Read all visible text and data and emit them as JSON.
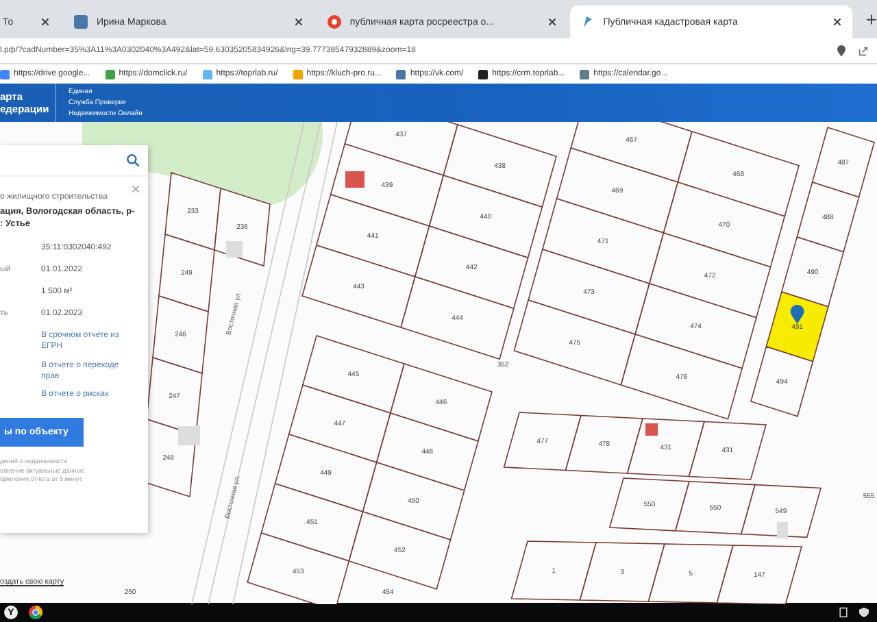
{
  "tabs": [
    {
      "title": "То",
      "kind": "plain",
      "selected": false
    },
    {
      "title": "Ирина Маркова",
      "kind": "vk",
      "selected": false
    },
    {
      "title": "публичная карта росреестра о...",
      "kind": "yandex",
      "selected": false
    },
    {
      "title": "Публичная кадастровая карта",
      "kind": "cadastre",
      "selected": true
    }
  ],
  "new_tab": "+",
  "address_bar": {
    "url": "l.рф/?cadNumber=35%3A11%3A0302040%3A492&lat=59.63035205834926&lng=39.77738547932889&zoom=18"
  },
  "bookmarks": [
    "https://drive.google...",
    "https://domclick.ru/",
    "https://toprlab.ru/",
    "https://kluch-pro.ru...",
    "https://vk.com/",
    "https://crm.toprlab...",
    "https://calendar.go..."
  ],
  "header": {
    "brand": [
      "арта",
      "едерации"
    ],
    "service": [
      "Единая",
      "Служба Проверки",
      "Недвижимости Онлайн"
    ]
  },
  "panel": {
    "type_line": "о жилищного строительства",
    "address_lines": [
      "ация, Вологодская область, р-",
      ": Устье"
    ],
    "fields": [
      {
        "value": "35:11:0302040:492"
      },
      {
        "label": "ый",
        "value": "01.01.2022"
      },
      {
        "value": "1 500 м²"
      },
      {
        "label": "ть",
        "value": "01.02.2023"
      }
    ],
    "links": [
      "В срочном отчете из ЕГРН",
      "В отчете о переходе прав",
      "В отчете о рисках"
    ],
    "button": "ы по объекту",
    "note_lines": [
      "дений о недвижимости",
      "олнение актуальные данные",
      "ормления отчета от 5 минут"
    ]
  },
  "create_map_link": "оздать свою карту",
  "map": {
    "blocks": [
      {
        "rows": [
          [
            {
              "n": "437",
              "selected": false
            },
            {
              "n": "438",
              "selected": false
            }
          ],
          [
            {
              "n": "439",
              "selected": false
            },
            {
              "n": "440",
              "selected": false
            }
          ],
          [
            {
              "n": "441",
              "selected": false
            },
            {
              "n": "442",
              "selected": false
            }
          ],
          [
            {
              "n": "443",
              "selected": false
            },
            {
              "n": "444",
              "selected": false
            }
          ]
        ]
      },
      {
        "rows": [
          [
            {
              "n": "467",
              "selected": false
            },
            {
              "n": "468",
              "selected": false
            }
          ],
          [
            {
              "n": "469",
              "selected": false
            },
            {
              "n": "470",
              "selected": false
            }
          ],
          [
            {
              "n": "471",
              "selected": false
            },
            {
              "n": "472",
              "selected": false
            }
          ],
          [
            {
              "n": "473",
              "selected": false
            },
            {
              "n": "474",
              "selected": false
            }
          ],
          [
            {
              "n": "475",
              "selected": false
            },
            {
              "n": "476",
              "selected": false
            }
          ]
        ]
      },
      {
        "rows": [
          [
            {
              "n": "487",
              "selected": false
            }
          ],
          [
            {
              "n": "488",
              "selected": false
            }
          ],
          [
            {
              "n": "490",
              "selected": false
            }
          ],
          [
            {
              "n": "491",
              "selected": true
            }
          ],
          [
            {
              "n": "494",
              "selected": false
            }
          ]
        ]
      },
      {
        "rows": [
          [
            {
              "n": "445",
              "selected": false
            },
            {
              "n": "446",
              "selected": false
            }
          ],
          [
            {
              "n": "447",
              "selected": false
            },
            {
              "n": "448",
              "selected": false
            }
          ],
          [
            {
              "n": "449",
              "selected": false
            },
            {
              "n": "450",
              "selected": false
            }
          ],
          [
            {
              "n": "451",
              "selected": false
            },
            {
              "n": "452",
              "selected": false
            }
          ],
          [
            {
              "n": "453",
              "selected": false
            }
          ]
        ]
      },
      {
        "rows": [
          [
            {
              "n": "233",
              "selected": false
            },
            {
              "n": "236",
              "selected": false
            }
          ],
          [
            {
              "n": "249",
              "selected": false
            }
          ],
          [
            {
              "n": "246",
              "selected": false
            }
          ],
          [
            {
              "n": "247",
              "selected": false
            }
          ],
          [
            {
              "n": "248",
              "selected": false
            }
          ]
        ]
      },
      {
        "rows": [
          [
            {
              "n": "477",
              "selected": false
            },
            {
              "n": "478",
              "selected": false
            },
            {
              "n": "431",
              "selected": false
            },
            {
              "n": "431",
              "selected": false
            }
          ]
        ]
      },
      {
        "rows": [
          [
            {
              "n": "550",
              "selected": false
            },
            {
              "n": "550",
              "selected": false
            },
            {
              "n": "549",
              "selected": false
            }
          ]
        ]
      },
      {
        "rows": [
          [
            {
              "n": "1",
              "selected": false
            },
            {
              "n": "3",
              "selected": false
            },
            {
              "n": "5",
              "selected": false
            },
            {
              "n": "147",
              "selected": false
            }
          ]
        ]
      }
    ],
    "other_labels": [
      "352",
      "250",
      "454",
      "555"
    ],
    "street_labels": [
      "Восточная ул.",
      "Восточная ул."
    ]
  },
  "taskbar": {
    "start_logo": "Y"
  }
}
